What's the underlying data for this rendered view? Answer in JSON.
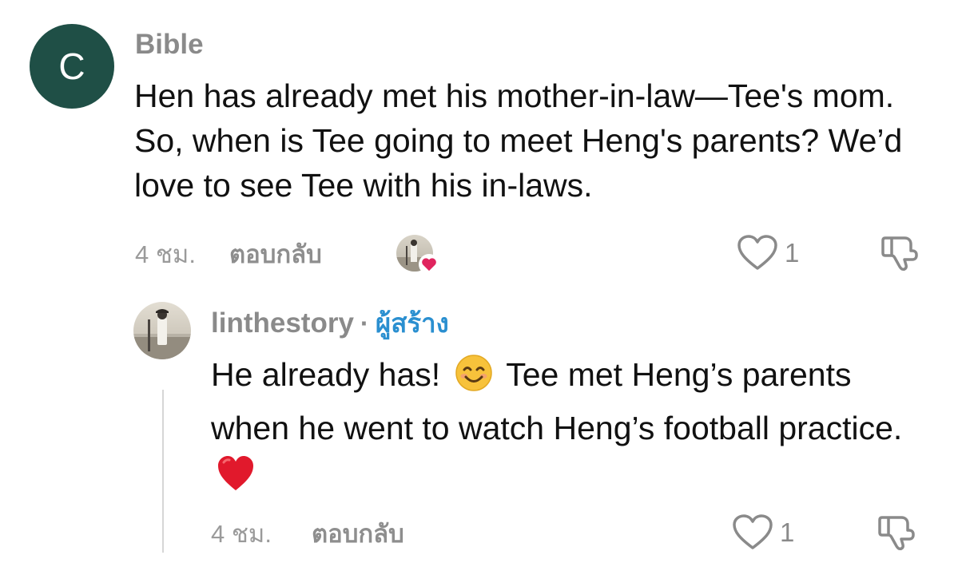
{
  "comment": {
    "avatar_letter": "C",
    "avatar_color": "#1f4f46",
    "username": "Bible",
    "text": "Hen has already met his mother-in-law—Tee's mom. So, when is Tee going to meet Heng's parents? We’d love to see Tee with his in-laws.",
    "time": "4 ชม.",
    "reply_label": "ตอบกลับ",
    "liked_by_creator_icon": "heart-icon",
    "like_icon": "heart-outline-icon",
    "like_count": "1",
    "dislike_icon": "thumbs-down-icon"
  },
  "reply": {
    "username": "linthestory",
    "separator": "·",
    "creator_badge": "ผู้สร้าง",
    "text_part1": "He already has!",
    "text_emoji_1": "smiling-face-icon",
    "text_part2": "Tee met Heng’s parents when he went to watch Heng’s football practice.",
    "text_emoji_2": "red-heart-icon",
    "time": "4 ชม.",
    "reply_label": "ตอบกลับ",
    "like_icon": "heart-outline-icon",
    "like_count": "1",
    "dislike_icon": "thumbs-down-icon"
  },
  "colors": {
    "creator_badge": "#2a8fd0",
    "muted_text": "#8a8a8a",
    "heart_red": "#e0245e"
  }
}
